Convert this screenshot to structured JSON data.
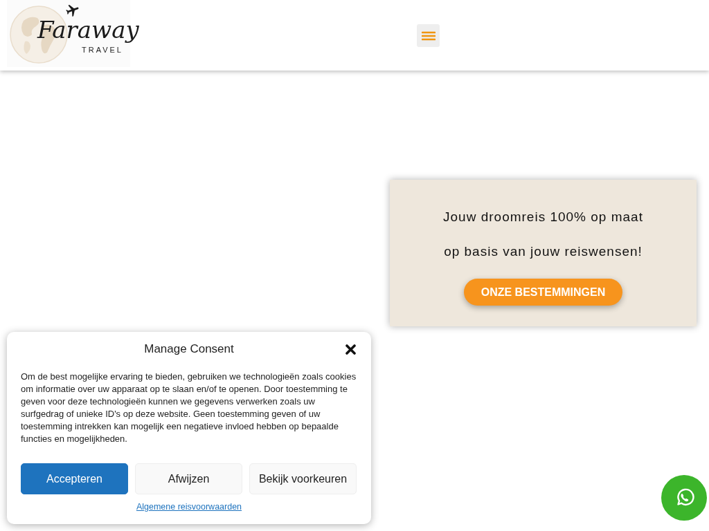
{
  "header": {
    "logo": {
      "name": "Faraway",
      "tagline": "TRAVEL"
    }
  },
  "hero_card": {
    "lines": [
      "Jouw droomreis 100% op maat",
      "op basis van jouw reiswensen!"
    ],
    "button": {
      "label": "ONZE BESTEMMINGEN"
    }
  },
  "consent_dialog": {
    "title": "Manage Consent",
    "body": "Om de best mogelijke ervaring te bieden, gebruiken we technologieën zoals cookies om informatie over uw apparaat op te slaan en/of te openen. Door toestemming te geven voor deze technologieën kunnen we gegevens verwerken zoals uw surfgedrag of unieke ID's op deze website. Geen toestemming geven of uw toestemming intrekken kan mogelijk een negatieve invloed hebben op bepaalde functies en mogelijkheden.",
    "buttons": [
      {
        "label": "Accepteren",
        "kind": "primary"
      },
      {
        "label": "Afwijzen",
        "kind": "secondary"
      },
      {
        "label": "Bekijk voorkeuren",
        "kind": "secondary"
      }
    ],
    "link": "Algemene reisvoorwaarden"
  }
}
